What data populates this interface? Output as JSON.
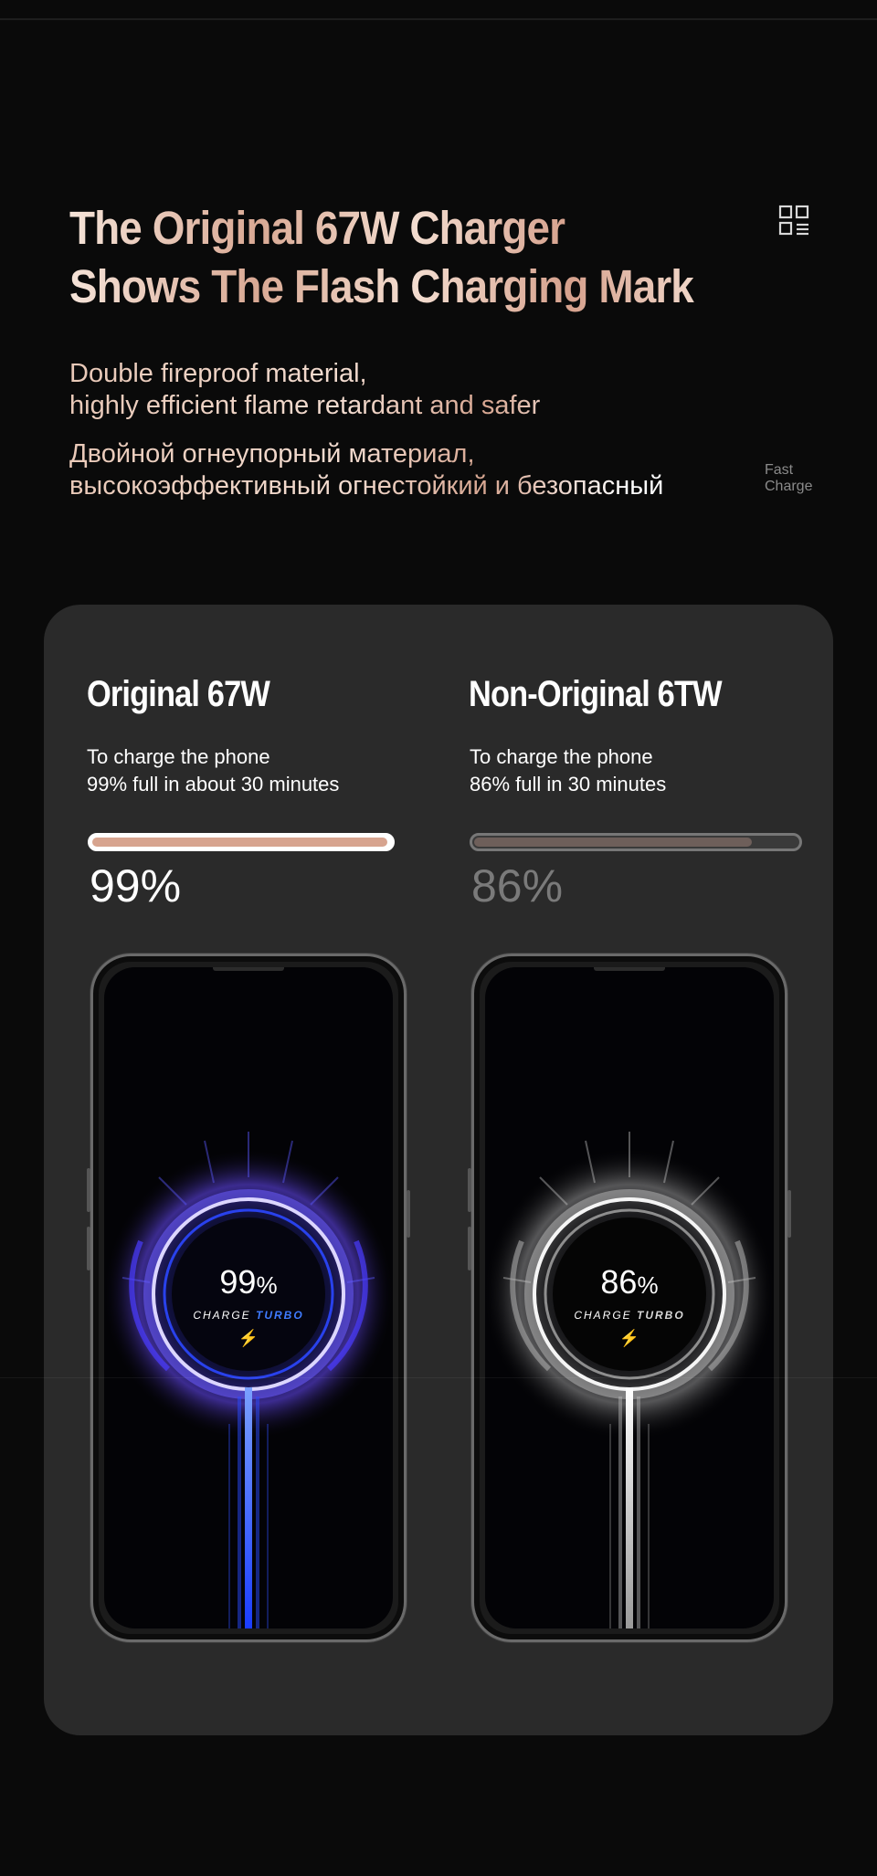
{
  "header": {
    "title_line1": "The Original 67W Charger",
    "title_line2": "Shows The Flash Charging Mark",
    "qr_icon": "qr-code-icon"
  },
  "description": {
    "en_line1": "Double fireproof material,",
    "en_line2": "highly efficient flame retardant and safer",
    "ru_line1": "Двойной огнеупорный материал,",
    "ru_line2": "высокоэффективный огнестойкий и безопасный"
  },
  "side_note": {
    "line1": "Fast",
    "line2": "Charge"
  },
  "comparison": {
    "original": {
      "title": "Original 67W",
      "desc_line1": "To charge the phone",
      "desc_line2": "99% full in about 30 minutes",
      "percent_label": "99%",
      "progress": 0.99,
      "screen_number": "99",
      "screen_unit": "%",
      "screen_charge": "CHARGE",
      "screen_turbo": "TURBO",
      "accent_color": "#3b5bff"
    },
    "non_original": {
      "title": "Non-Original 6TW",
      "desc_line1": "To charge the phone",
      "desc_line2": "86% full in 30 minutes",
      "percent_label": "86%",
      "progress": 0.86,
      "screen_number": "86",
      "screen_unit": "%",
      "screen_charge": "CHARGE",
      "screen_turbo": "TURBO",
      "accent_color": "#d0d0d0"
    }
  },
  "colors": {
    "background": "#0a0a0a",
    "card": "#2a2a2a",
    "accent_gold": "#d7a48f"
  }
}
